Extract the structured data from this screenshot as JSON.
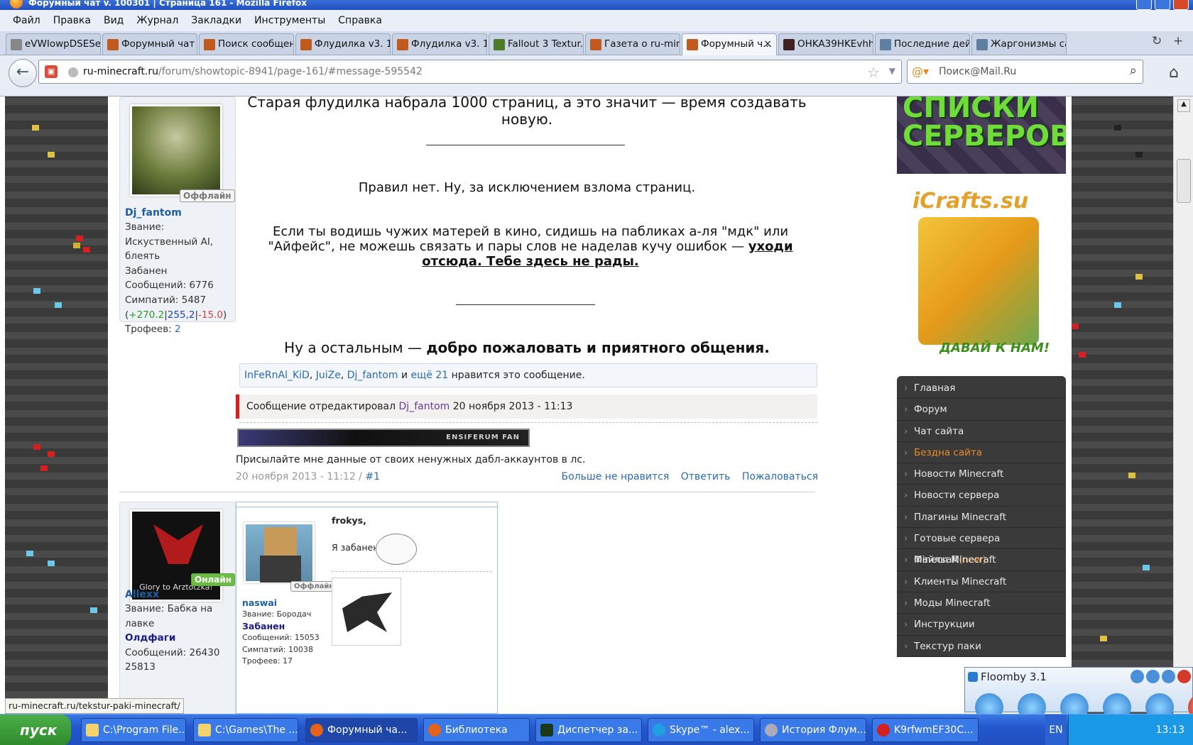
{
  "window": {
    "title": "Форумный чат v. 100301 | Страница 161 - Mozilla Firefox"
  },
  "menu": [
    "Файл",
    "Правка",
    "Вид",
    "Журнал",
    "Закладки",
    "Инструменты",
    "Справка"
  ],
  "tabs": [
    {
      "label": "eVWIowpDSESe..."
    },
    {
      "label": "Форумный чат ..."
    },
    {
      "label": "Поиск сообщен..."
    },
    {
      "label": "Флудилка v3. 1..."
    },
    {
      "label": "Флудилка v3. 1..."
    },
    {
      "label": "Fallout 3 Textur..."
    },
    {
      "label": "Газета о ru-min..."
    },
    {
      "label": "Форумный ч...",
      "active": true,
      "close": "×"
    },
    {
      "label": "OHKA39HKEvhh..."
    },
    {
      "label": "Последние дей..."
    },
    {
      "label": "Жаргонизмы са..."
    }
  ],
  "nav": {
    "url_host": "ru-minecraft.ru",
    "url_path": "/forum/showtopic-8941/page-161/#message-595542",
    "search_placeholder": "Поиск@Mail.Ru"
  },
  "post1": {
    "user": {
      "name": "Dj_fantom",
      "status": "Оффлайн",
      "rank": "Звание: Искуственный AI, блеять",
      "banned": "Забанен",
      "messages": "Сообщений: 6776",
      "likes": "Симпатий: 5487",
      "rep_pos": "+270.2",
      "rep_mid": "255,2",
      "rep_neg": "-15.0",
      "trophies_label": "Трофеев:",
      "trophies": "2"
    },
    "line1": "Старая флудилка набрала 1000 страниц, а это значит — время создавать новую.",
    "rules": "Правил нет. Ну, за исключением взлома страниц.",
    "warn_text": "Если ты водишь чужих матерей в кино, сидишь на пабликах а-ля \"мдк\" или \"Айфейс\", не можешь связать и пары слов не наделав кучу ошибок —",
    "warn_bold": "уходи отсюда. Тебе здесь не рады.",
    "welcome_pre": "Ну а остальным —",
    "welcome_bold": "добро пожаловать и приятного общения.",
    "likes": {
      "u1": "InFeRnAl_KiD",
      "u2": "JuiZe",
      "u3": "Dj_fantom",
      "and": "и",
      "more": "ещё 21",
      "suffix": "нравится это сообщение."
    },
    "edited": {
      "pre": "Сообщение отредактировал",
      "user": "Dj_fantom",
      "date": "20 ноября 2013 - 11:13"
    },
    "sig_banner": "ENSIFERUM FAN",
    "signature": "Присылайте мне данные от своих ненужных дабл-аккаунтов в лс.",
    "date": "20 ноября 2013 - 11:12 /",
    "num": "#1",
    "actions": [
      "Больше не нравится",
      "Ответить",
      "Пожаловаться"
    ]
  },
  "post2": {
    "user": {
      "name": "Allexx",
      "status": "Онлайн",
      "avatar_caption": "Glory to Arztotzka!",
      "rank": "Звание: Бабка на лавке",
      "group": "Олдфаги",
      "messages": "Сообщений: 26430",
      "extra": "25813"
    },
    "embed": {
      "name": "naswai",
      "status": "Оффлайн",
      "rank": "Звание: Бородач",
      "banned": "Забанен",
      "messages": "Сообщений: 15053",
      "likes": "Симпатий: 10038",
      "trophies": "Трофеев: 17",
      "quote_user": "frokys,",
      "quote_text": "Я забанен."
    }
  },
  "sidebar": {
    "banner1": "СПИСКИ СЕРВЕРОВ",
    "banner2_logo": "iCrafts.su",
    "banner2_cta": "ДАВАЙ К НАМ!",
    "menu": [
      "Главная",
      "Форум",
      "Чат сайта",
      "Бездна сайта",
      "Новости Minecraft",
      "Новости сервера",
      "Плагины Minecraft",
      "Готовые сервера Minecraft",
      "Файлы Minecraft",
      "Клиенты Minecraft",
      "Моды Minecraft",
      "Инструкции",
      "Текстур паки"
    ],
    "menu_new": "(new)"
  },
  "floomby": {
    "title": "Floomby 3.1"
  },
  "status_url": "ru-minecraft.ru/tekstur-paki-minecraft/",
  "taskbar": {
    "start": "пуск",
    "tasks": [
      "C:\\Program File...",
      "C:\\Games\\The ...",
      "Форумный ча...",
      "Библиотека",
      "Диспетчер за...",
      "Skype™ - alex...",
      "История Флум...",
      "K9rfwmEF30C..."
    ],
    "lang": "EN",
    "clock": "13:13"
  }
}
